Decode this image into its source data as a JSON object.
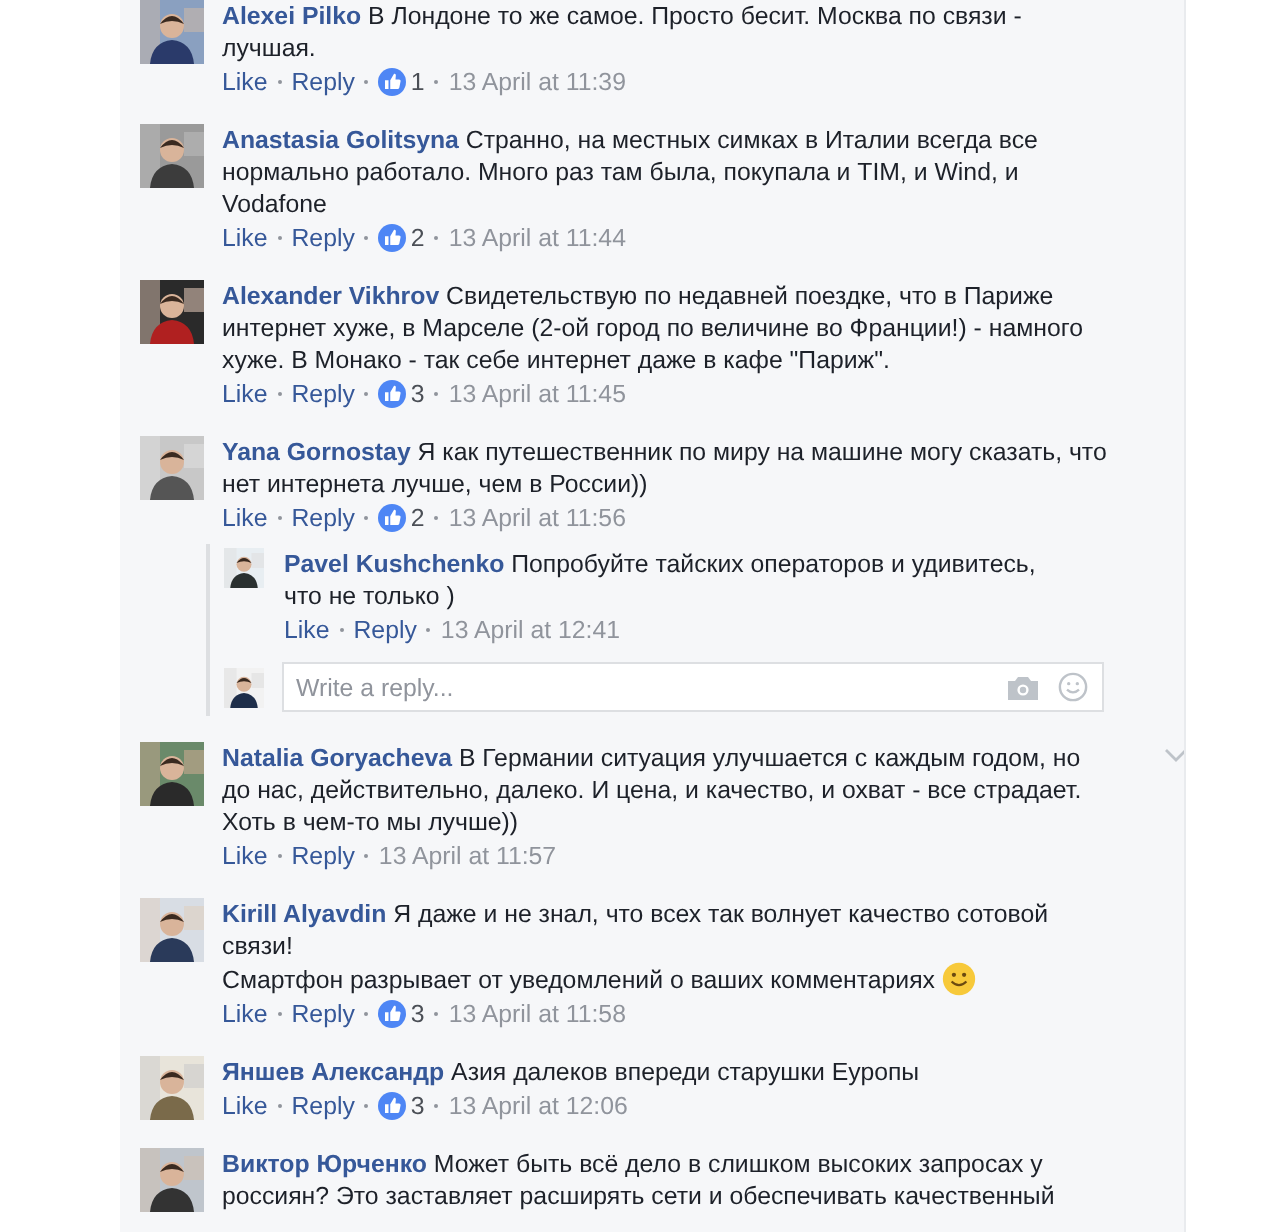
{
  "comments": [
    {
      "author": "Alexei Pilko",
      "text": "В Лондоне то же самое. Просто бесит. Москва по связи - лучшая.",
      "smiley": false,
      "like_label": "Like",
      "reply_label": "Reply",
      "likes": "1",
      "time": "13 April at 11:39",
      "options_shown": false
    },
    {
      "author": "Anastasia Golitsyna",
      "text": "Странно, на местных симках в Италии всегда все нормально работало. Много раз там была, покупала и TIM, и Wind, и Vodafone",
      "smiley": false,
      "like_label": "Like",
      "reply_label": "Reply",
      "likes": "2",
      "time": "13 April at 11:44",
      "options_shown": false
    },
    {
      "author": "Alexander Vikhrov",
      "text": "Свидетельствую по недавней поездке, что в Париже интернет хуже, в Марселе (2-ой город по величине во Франции!) - намного хуже. В Монако - так себе интернет даже в кафе \"Париж\".",
      "smiley": false,
      "like_label": "Like",
      "reply_label": "Reply",
      "likes": "3",
      "time": "13 April at 11:45",
      "options_shown": false
    },
    {
      "author": "Yana Gornostay",
      "text": "Я как путешественник по миру на машине могу сказать, что нет интернета лучше, чем в России))",
      "smiley": false,
      "like_label": "Like",
      "reply_label": "Reply",
      "likes": "2",
      "time": "13 April at 11:56",
      "options_shown": false,
      "replies": [
        {
          "author": "Pavel Kushchenko",
          "text": "Попробуйте тайских операторов и удивитесь, что не только )",
          "like_label": "Like",
          "reply_label": "Reply",
          "time": "13 April at 12:41"
        }
      ],
      "reply_box": {
        "placeholder": "Write a reply..."
      }
    },
    {
      "author": "Natalia Goryacheva",
      "text": "В Германии ситуация улучшается с каждым годом, но до нас, действительно, далеко. И цена, и качество, и охват - все страдает. Хоть в чем-то мы лучше))",
      "smiley": false,
      "like_label": "Like",
      "reply_label": "Reply",
      "time": "13 April at 11:57",
      "options_shown": true
    },
    {
      "author": "Kirill Alyavdin",
      "text": "Я даже и не знал, что всех так волнует качество сотовой связи!\nСмартфон разрывает от уведомлений о ваших комментариях",
      "smiley": true,
      "like_label": "Like",
      "reply_label": "Reply",
      "likes": "3",
      "time": "13 April at 11:58",
      "options_shown": false
    },
    {
      "author": "Яншев Александр",
      "text": "Азия далеков впереди старушки Еуропы",
      "smiley": false,
      "like_label": "Like",
      "reply_label": "Reply",
      "likes": "3",
      "time": "13 April at 12:06",
      "options_shown": false
    },
    {
      "author": "Виктор Юрченко",
      "text": "Может быть всё дело в слишком высоких запросах у россиян? Это заставляет расширять сети и обеспечивать качественный",
      "smiley": false,
      "options_shown": false
    }
  ]
}
